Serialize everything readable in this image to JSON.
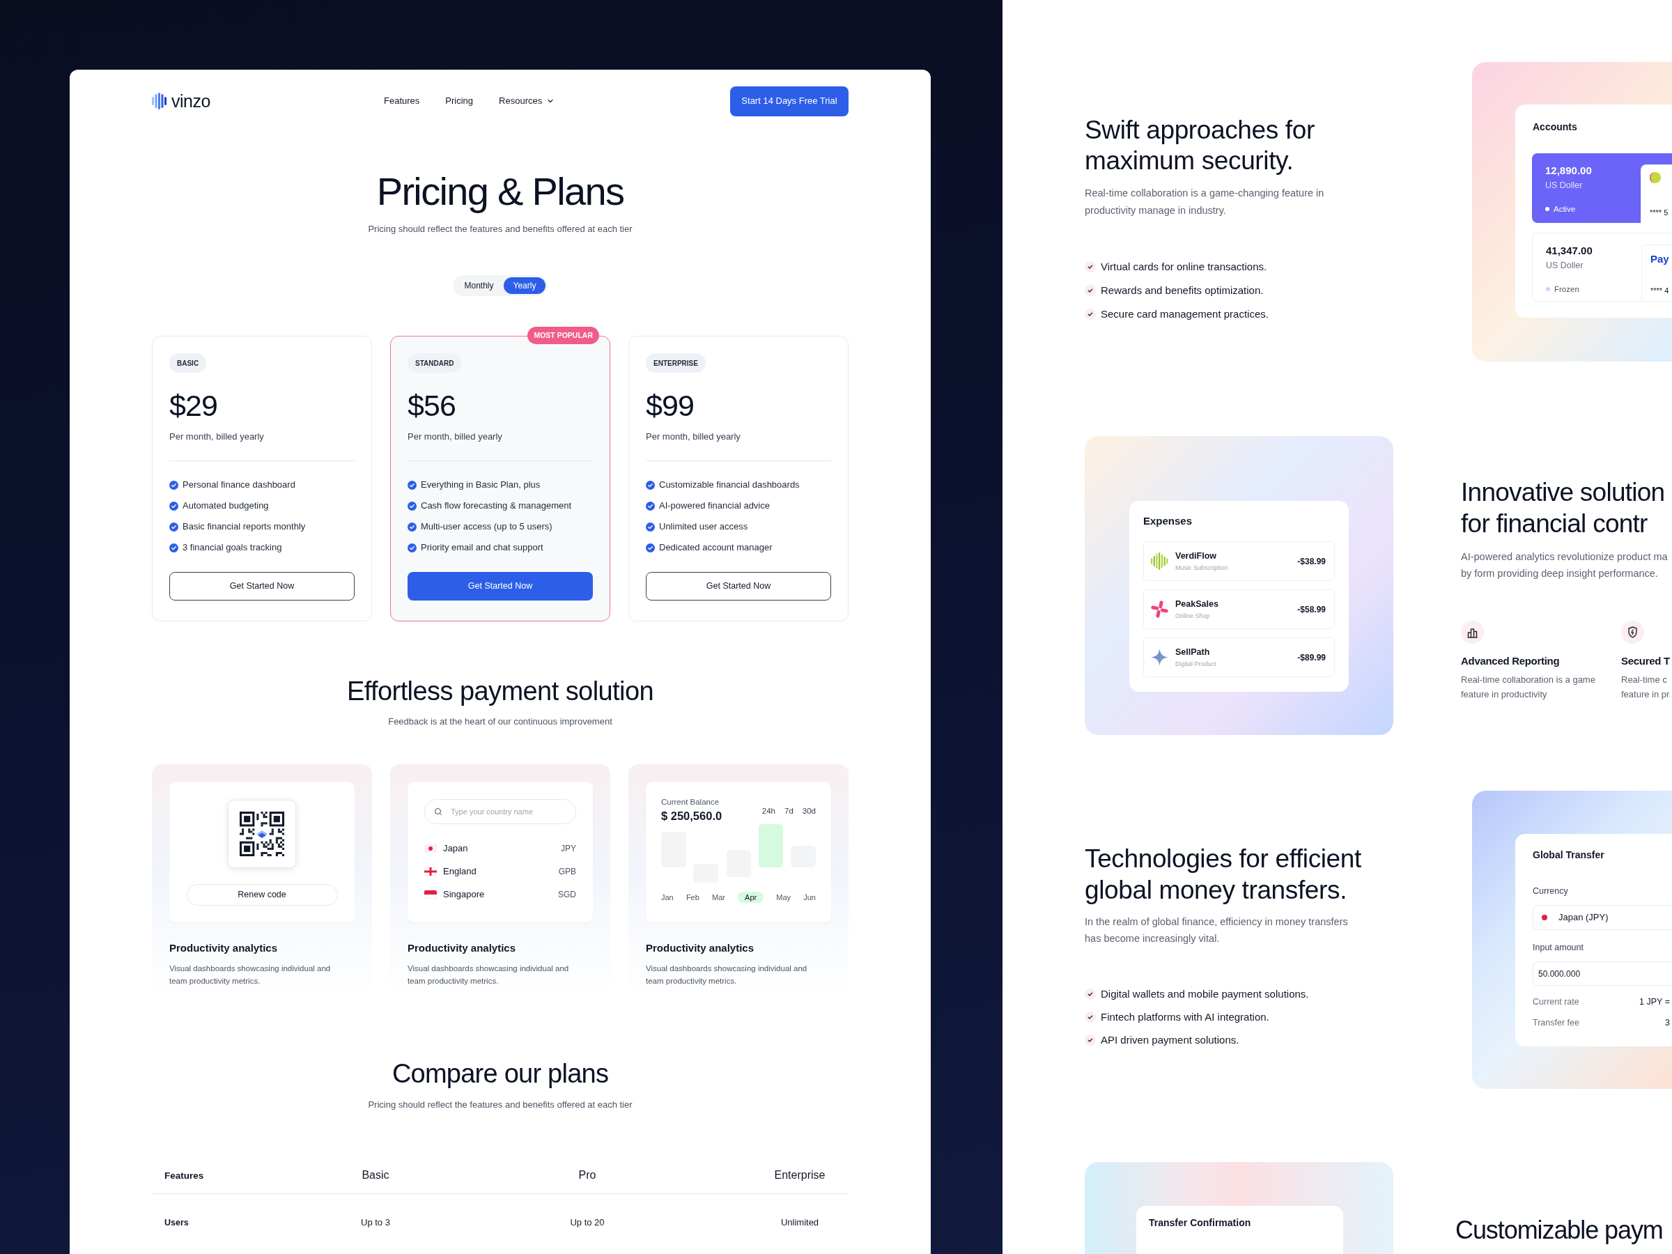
{
  "left_page": {
    "nav": {
      "logo": "vinzo",
      "links": [
        {
          "label": "Features",
          "has_menu": false
        },
        {
          "label": "Pricing",
          "has_menu": false
        },
        {
          "label": "Resources",
          "has_menu": true
        }
      ],
      "cta": "Start 14 Days Free Trial"
    },
    "pricing": {
      "title": "Pricing & Plans",
      "subtitle": "Pricing should reflect the features and benefits offered at each tier",
      "billing_toggle": [
        {
          "label": "Monthly",
          "selected": false
        },
        {
          "label": "Yearly",
          "selected": true
        }
      ],
      "plans": [
        {
          "tier": "BASIC",
          "price": "$29",
          "period": "Per month, billed yearly",
          "features": [
            "Personal finance dashboard",
            "Automated budgeting",
            "Basic financial reports monthly",
            "3 financial goals tracking"
          ],
          "button": "Get Started Now",
          "highlighted": false
        },
        {
          "tier": "STANDARD",
          "badge": "MOST POPULAR",
          "price": "$56",
          "period": "Per month, billed yearly",
          "features": [
            "Everything in Basic Plan, plus",
            "Cash flow forecasting & management",
            "Multi-user access (up to 5 users)",
            "Priority email and chat support"
          ],
          "button": "Get Started Now",
          "highlighted": true
        },
        {
          "tier": "ENTERPRISE",
          "price": "$99",
          "period": "Per month, billed yearly",
          "features": [
            "Customizable financial dashboards",
            "AI-powered financial advice",
            "Unlimited user access",
            "Dedicated account manager"
          ],
          "button": "Get Started Now",
          "highlighted": false
        }
      ]
    },
    "payment": {
      "title": "Effortless payment solution",
      "subtitle": "Feedback is at the heart of our continuous improvement",
      "cards": [
        {
          "kind": "qr",
          "button": "Renew code",
          "title": "Productivity analytics",
          "description": "Visual dashboards showcasing individual and team productivity metrics."
        },
        {
          "kind": "countries",
          "search_placeholder": "Type your country name",
          "countries": [
            {
              "name": "Japan",
              "code": "JPY"
            },
            {
              "name": "England",
              "code": "GPB"
            },
            {
              "name": "Singapore",
              "code": "SGD"
            }
          ],
          "title": "Productivity analytics",
          "description": "Visual dashboards showcasing individual and team productivity metrics."
        },
        {
          "kind": "balance",
          "label": "Current Balance",
          "amount": "$ 250,560.0",
          "ranges": [
            "24h",
            "7d",
            "30d"
          ],
          "months": [
            {
              "label": "Jan",
              "selected": false
            },
            {
              "label": "Feb",
              "selected": false
            },
            {
              "label": "Mar",
              "selected": false
            },
            {
              "label": "Apr",
              "selected": true
            },
            {
              "label": "May",
              "selected": false
            },
            {
              "label": "Jun",
              "selected": false
            }
          ],
          "title": "Productivity analytics",
          "description": "Visual dashboards showcasing individual and team productivity metrics."
        }
      ]
    },
    "compare": {
      "title": "Compare our plans",
      "subtitle": "Pricing should reflect the features and benefits offered at each tier",
      "columns": [
        "Features",
        "Basic",
        "Pro",
        "Enterprise"
      ],
      "rows": [
        [
          "Users",
          "Up to 3",
          "Up to 20",
          "Unlimited"
        ]
      ]
    }
  },
  "right_page": {
    "security": {
      "title": "Swift approaches for maximum security.",
      "description": "Real-time collaboration is a game-changing feature in productivity manage in industry.",
      "checklist": [
        "Virtual cards for online transactions.",
        "Rewards and benefits optimization.",
        "Secure card management practices."
      ],
      "accounts": {
        "title": "Accounts",
        "items": [
          {
            "amount": "12,890.00",
            "currency": "US Doller",
            "status": "Active",
            "color": "#ffffff",
            "selected": true,
            "card_number": "**** 5"
          },
          {
            "amount": "41,347.00",
            "currency": "US Doller",
            "status": "Frozen",
            "color": "#c7d2fe",
            "selected": false,
            "card_brand": "Pay",
            "card_number": "**** 4"
          }
        ]
      }
    },
    "expenses": {
      "widget": {
        "title": "Expenses",
        "items": [
          {
            "name": "VerdiFlow",
            "category": "Music Subscription",
            "amount": "-$38.99"
          },
          {
            "name": "PeakSales",
            "category": "Online Shop",
            "amount": "-$58.99"
          },
          {
            "name": "SellPath",
            "category": "Digital Product",
            "amount": "-$89.99"
          }
        ]
      },
      "title_lines": [
        "Innovative solution",
        "for financial contr"
      ],
      "description_lines": [
        "AI-powered analytics revolutionize product ma",
        "by form providing deep insight performance."
      ],
      "features": [
        {
          "title": "Advanced Reporting",
          "description_lines": [
            "Real-time collaboration is a game",
            "feature in productivity"
          ]
        },
        {
          "title": "Secured T",
          "description_lines": [
            "Real-time c",
            "feature in pr"
          ]
        }
      ]
    },
    "transfer": {
      "title": "Technologies for efficient global money transfers.",
      "description": "In the realm of global finance, efficiency in money transfers has become increasingly vital.",
      "checklist": [
        "Digital wallets and mobile payment solutions.",
        "Fintech platforms with AI integration.",
        "API driven payment solutions."
      ],
      "widget": {
        "title": "Global Transfer",
        "currency_label": "Currency",
        "currency": "Japan (JPY)",
        "amount_label": "Input amount",
        "amount": "50.000.000",
        "details": [
          {
            "label": "Current rate",
            "value": "1 JPY ="
          },
          {
            "label": "Transfer fee",
            "value": "3"
          }
        ]
      }
    },
    "confirmation": {
      "widget_title": "Transfer Confirmation",
      "title": "Customizable paym"
    }
  }
}
